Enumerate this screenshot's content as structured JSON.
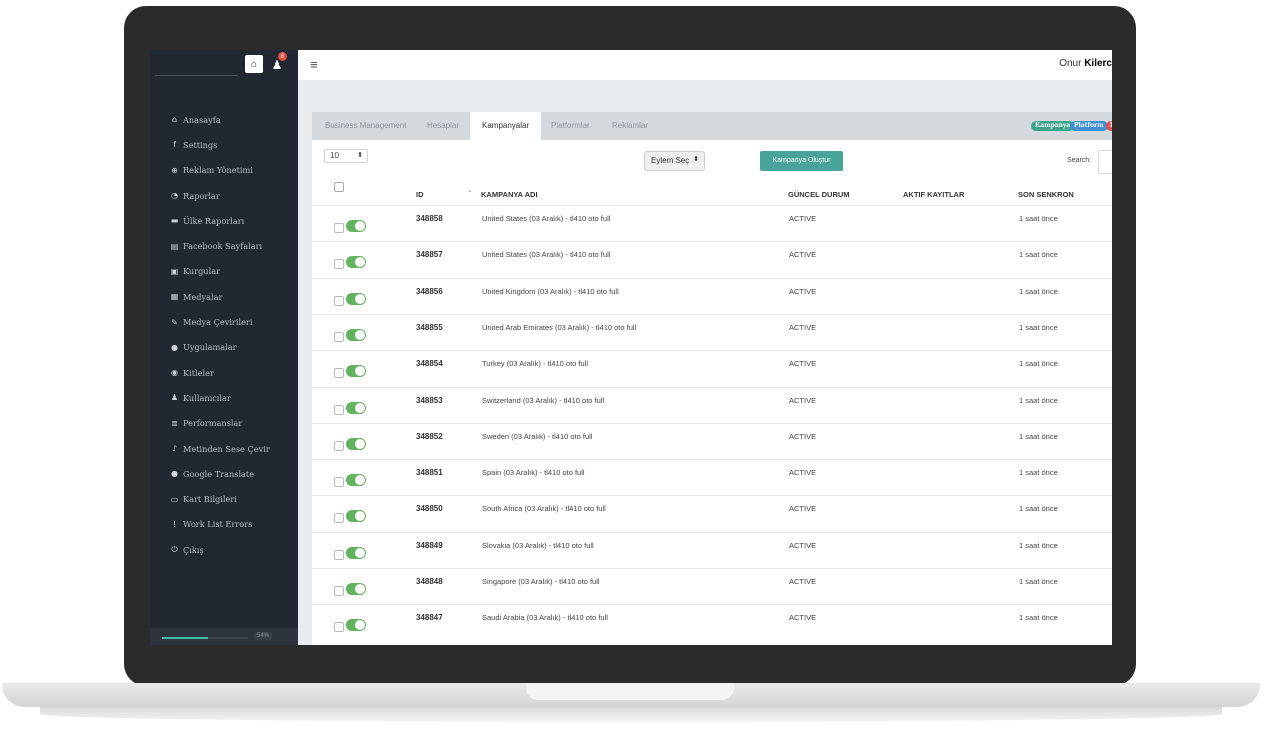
{
  "sidebar": {
    "home_icon": "home-icon",
    "user_badge": "8",
    "items": [
      {
        "icon": "home-icon",
        "glyph": "⌂",
        "label": "Anasayfa"
      },
      {
        "icon": "facebook-icon",
        "glyph": "f",
        "label": "Settings"
      },
      {
        "icon": "target-icon",
        "glyph": "⊕",
        "label": "Reklam Yönetimi"
      },
      {
        "icon": "dashboard-icon",
        "glyph": "◔",
        "label": "Raporlar"
      },
      {
        "icon": "database-icon",
        "glyph": "▬",
        "label": "Ülke Raporları"
      },
      {
        "icon": "newspaper-icon",
        "glyph": "▤",
        "label": "Facebook Sayfaları"
      },
      {
        "icon": "film-icon",
        "glyph": "▣",
        "label": "Kurgular"
      },
      {
        "icon": "image-icon",
        "glyph": "▦",
        "label": "Medyalar"
      },
      {
        "icon": "pencil-icon",
        "glyph": "✎",
        "label": "Medya Çevirileri"
      },
      {
        "icon": "apple-icon",
        "glyph": "●",
        "label": "Uygulamalar"
      },
      {
        "icon": "globe-icon",
        "glyph": "◉",
        "label": "Kitleler"
      },
      {
        "icon": "user-icon",
        "glyph": "♟",
        "label": "Kullanıcılar"
      },
      {
        "icon": "list-icon",
        "glyph": "≣",
        "label": "Performanslar"
      },
      {
        "icon": "speech-icon",
        "glyph": "♪",
        "label": "Metinden Sese Çevir"
      },
      {
        "icon": "comments-icon",
        "glyph": "●",
        "label": "Google Translate"
      },
      {
        "icon": "credit-card-icon",
        "glyph": "▭",
        "label": "Kart Bilgileri"
      },
      {
        "icon": "exclamation-icon",
        "glyph": "!",
        "label": "Work List Errors"
      },
      {
        "icon": "power-icon",
        "glyph": "⏻",
        "label": "Çıkış"
      }
    ],
    "progress_value": 0.54,
    "progress_label": "54%"
  },
  "topbar": {
    "user_first": "Onur",
    "user_last": "Kilerc"
  },
  "tabs": [
    {
      "label": "Business Management",
      "active": false
    },
    {
      "label": "Hesaplar",
      "active": false
    },
    {
      "label": "Kampanyalar",
      "active": true
    },
    {
      "label": "Platformlar",
      "active": false
    },
    {
      "label": "Reklamlar",
      "active": false
    }
  ],
  "pills": [
    {
      "label": "Kampanya",
      "color": "#3aa58a"
    },
    {
      "label": "Platform",
      "color": "#3b8ed8"
    },
    {
      "label": "P",
      "color": "#e0524a"
    }
  ],
  "controls": {
    "page_length": "10",
    "action_select": "Eylem Seç",
    "create_button": "Kampanya Oluştur",
    "search_label": "Search:"
  },
  "table": {
    "columns": {
      "id": "ID",
      "name": "KAMPANYA ADI",
      "status": "GÜNCEL DURUM",
      "active_records": "AKTIF KAYITLAR",
      "last_sync": "SON SENKRON"
    },
    "rows": [
      {
        "id": "348858",
        "name": "United States (03 Aralık) - tl410 oto full",
        "status": "ACTIVE",
        "sync": "1 saat önce"
      },
      {
        "id": "348857",
        "name": "United States (03 Aralık) - tl410 oto full",
        "status": "ACTIVE",
        "sync": "1 saat önce"
      },
      {
        "id": "348856",
        "name": "United Kingdom (03 Aralık) - tl410 oto full",
        "status": "ACTIVE",
        "sync": "1 saat önce"
      },
      {
        "id": "348855",
        "name": "United Arab Emirates (03 Aralık) - tl410 oto full",
        "status": "ACTIVE",
        "sync": "1 saat önce"
      },
      {
        "id": "348854",
        "name": "Turkey (03 Aralık) - tl410 oto full",
        "status": "ACTIVE",
        "sync": "1 saat önce"
      },
      {
        "id": "348853",
        "name": "Switzerland (03 Aralık) - tl410 oto full",
        "status": "ACTIVE",
        "sync": "1 saat önce"
      },
      {
        "id": "348852",
        "name": "Sweden (03 Aralık) - tl410 oto full",
        "status": "ACTIVE",
        "sync": "1 saat önce"
      },
      {
        "id": "348851",
        "name": "Spain (03 Aralık) - tl410 oto full",
        "status": "ACTIVE",
        "sync": "1 saat önce"
      },
      {
        "id": "348850",
        "name": "South Africa (03 Aralık) - tl410 oto full",
        "status": "ACTIVE",
        "sync": "1 saat önce"
      },
      {
        "id": "348849",
        "name": "Slovakia (03 Aralık) - tl410 oto full",
        "status": "ACTIVE",
        "sync": "1 saat önce"
      },
      {
        "id": "348848",
        "name": "Singapore (03 Aralık) - tl410 oto full",
        "status": "ACTIVE",
        "sync": "1 saat önce"
      },
      {
        "id": "348847",
        "name": "Saudi Arabia (03 Aralık) - tl410 oto full",
        "status": "ACTIVE",
        "sync": "1 saat önce"
      }
    ]
  },
  "colors": {
    "sidebar_bg": "#222831",
    "accent": "#4aa39a",
    "toggle_on": "#63b35e"
  }
}
